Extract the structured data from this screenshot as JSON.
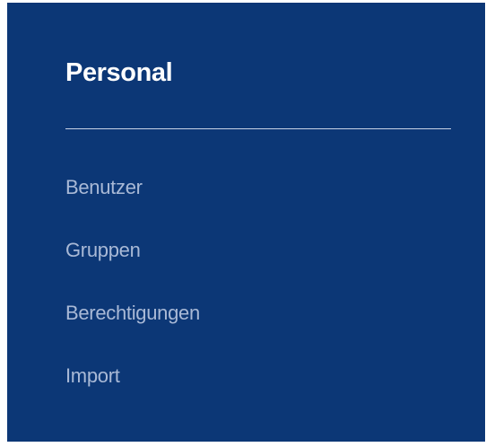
{
  "colors": {
    "panel_background": "#0c3776",
    "title_text": "#ffffff",
    "divider": "#c9d3e6",
    "menu_text": "#a9b9d6"
  },
  "sidebar": {
    "title": "Personal",
    "items": [
      {
        "label": "Benutzer"
      },
      {
        "label": "Gruppen"
      },
      {
        "label": "Berechtigungen"
      },
      {
        "label": "Import"
      }
    ]
  }
}
